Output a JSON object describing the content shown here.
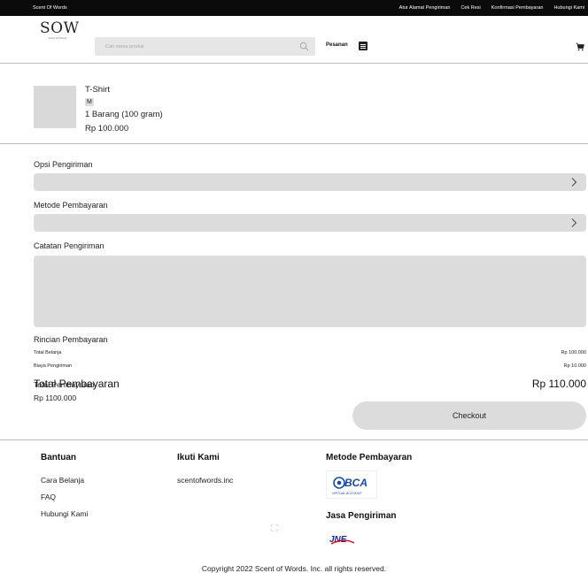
{
  "topbar": {
    "brand": "Scent Of Words",
    "links": [
      "Atur Alamat Pengiriman",
      "Cek Resi",
      "Konfirmasi Pembayaran",
      "Hubungi Kami"
    ]
  },
  "header": {
    "logo_text": "SOW",
    "logo_subtext": "Scent Of Words",
    "search_placeholder": "Cari nama produk",
    "orders_label": "Pesanan"
  },
  "product": {
    "name": "T-Shirt",
    "size": "M",
    "quantity": "1 Barang (100 gram)",
    "price": "Rp 100.000"
  },
  "form": {
    "shipping_option_label": "Opsi Pengiriman",
    "payment_method_label": "Metode Pembayaran",
    "shipping_notes_label": "Catatan Pengiriman"
  },
  "payment_details": {
    "title": "Rincian Pembayaran",
    "subtotal_label": "Total Belanja",
    "subtotal_value": "Rp 100.000",
    "shipping_label": "Biaya Pengiriman",
    "shipping_value": "Rp 10.000",
    "total_label": "Total Pembayaran",
    "total_value": "Rp 110.000"
  },
  "summary": {
    "label": "Total Pembayaran",
    "value": "Rp 1100.000",
    "checkout_label": "Checkout"
  },
  "footer": {
    "help_title": "Bantuan",
    "help_links": [
      "Cara Belanja",
      "FAQ",
      "Hubungi Kami"
    ],
    "follow_title": "Ikuti Kami",
    "follow_handle": "scentofwords.inc",
    "payment_title": "Metode Pembayaran",
    "bca_logo_text": "BCA",
    "bca_logo_subtext": "VIRTUAL ACCOUNT",
    "shipping_title": "Jasa Pengiriman",
    "jne_logo_text": "JNE",
    "copyright": "Copyright 2022 Scent of Words. Inc. all rights reserved."
  },
  "icons": {
    "search": "search-icon",
    "menu": "list-icon",
    "cart": "cart-icon",
    "chevron": "chevron-right-icon"
  },
  "colors": {
    "topbar_bg": "#0b0b0b",
    "field_bg": "#dcdcdc",
    "bca_blue": "#1a4aa8",
    "jne_blue": "#1b2a8f",
    "jne_red": "#d0021b"
  }
}
